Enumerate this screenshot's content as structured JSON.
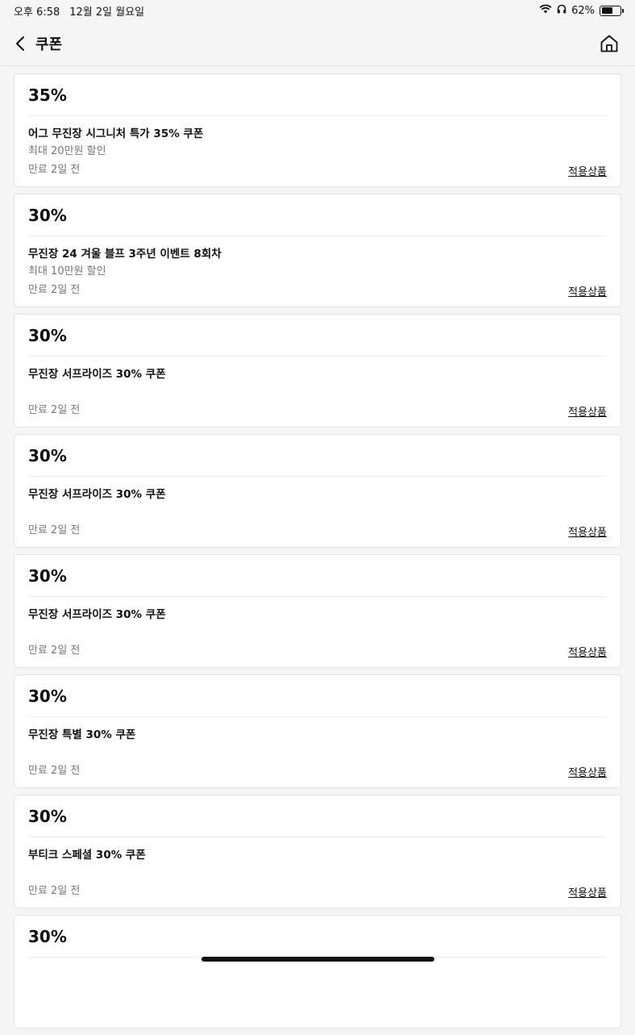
{
  "status_bar": {
    "time": "오후 6:58",
    "date": "12월 2일 월요일",
    "battery_pct_text": "62%",
    "battery_level": 0.62
  },
  "nav": {
    "title": "쿠폰"
  },
  "coupons": [
    {
      "percent": "35%",
      "name": "어그 무진장 시그니처 특가 35% 쿠폰",
      "max_discount": "최대 20만원 할인",
      "expiry": "만료 2일 전",
      "link": "적용상품"
    },
    {
      "percent": "30%",
      "name": "무진장 24 겨울 블프 3주년 이벤트 8회차",
      "max_discount": "최대 10만원 할인",
      "expiry": "만료 2일 전",
      "link": "적용상품"
    },
    {
      "percent": "30%",
      "name": "무진장 서프라이즈 30% 쿠폰",
      "max_discount": "",
      "expiry": "만료 2일 전",
      "link": "적용상품"
    },
    {
      "percent": "30%",
      "name": "무진장 서프라이즈 30% 쿠폰",
      "max_discount": "",
      "expiry": "만료 2일 전",
      "link": "적용상품"
    },
    {
      "percent": "30%",
      "name": "무진장 서프라이즈 30% 쿠폰",
      "max_discount": "",
      "expiry": "만료 2일 전",
      "link": "적용상품"
    },
    {
      "percent": "30%",
      "name": "무진장 특별 30% 쿠폰",
      "max_discount": "",
      "expiry": "만료 2일 전",
      "link": "적용상품"
    },
    {
      "percent": "30%",
      "name": "부티크 스페셜 30% 쿠폰",
      "max_discount": "",
      "expiry": "만료 2일 전",
      "link": "적용상품"
    },
    {
      "percent": "30%",
      "name": "",
      "max_discount": "",
      "expiry": "",
      "link": ""
    }
  ]
}
